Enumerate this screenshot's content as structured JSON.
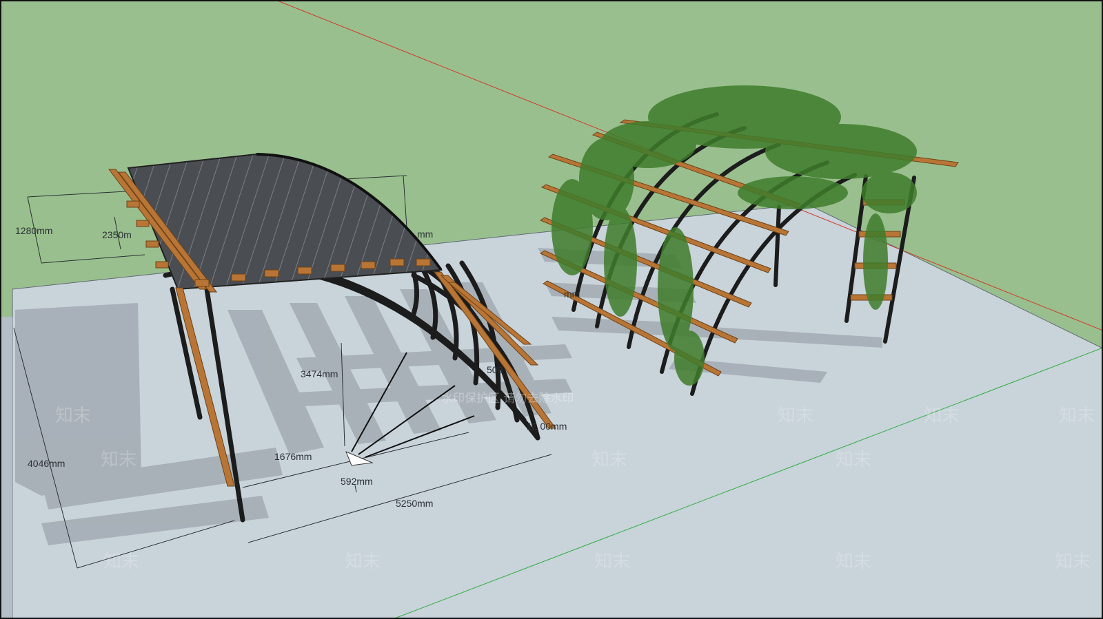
{
  "viewport": {
    "sky_color": "#99bf8e",
    "ground_color": "#c8d3da",
    "border_color": "#111111"
  },
  "axes": {
    "red_axis_color": "#d23a2a",
    "green_axis_color": "#2fae3f"
  },
  "dimensions": {
    "d_1280": "1280mm",
    "d_2350": "2350m",
    "d_mm_right": "mm",
    "d_3474": "3474mm",
    "d_1676": "1676mm",
    "d_592": "592mm",
    "d_5250": "5250mm",
    "d_4046": "4046mm",
    "d_12_00": "12   00mm",
    "d_500": "500",
    "d_mm_left": "mm"
  },
  "watermark": {
    "logo_text": "知末",
    "banner_text": "水印保护区 请勿去除水印"
  },
  "model": {
    "frame_color": "#1c1c1c",
    "timber_color": "#b87535",
    "roof_color": "#4a4d52",
    "vine_color": "#3f7d2c"
  }
}
